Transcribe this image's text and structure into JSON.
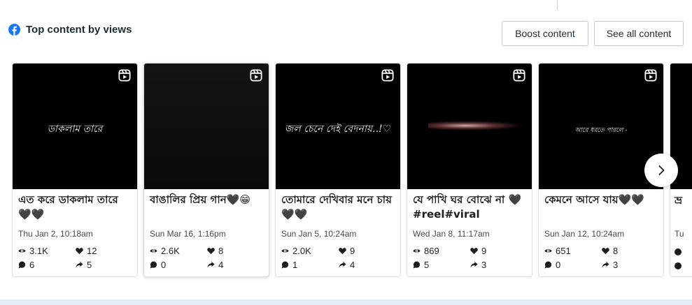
{
  "section": {
    "title": "Top content by views",
    "boost_label": "Boost content",
    "see_all_label": "See all content"
  },
  "colors": {
    "facebook_blue": "#1877f2",
    "border": "#dadde1",
    "thumbnail_bg": "#000000"
  },
  "cards": [
    {
      "thumb_text": "ডাকলাম তারে",
      "caption": "এত করে ডাকলাম তারে 🖤🖤",
      "date": "Thu Jan 2, 10:18am",
      "views": "3.1K",
      "likes": "12",
      "comments": "6",
      "shares": "5"
    },
    {
      "thumb_text": "",
      "caption": "বাঙালির প্রিয় গান🖤😁",
      "date": "Sun Mar 16, 1:16pm",
      "views": "2.6K",
      "likes": "8",
      "comments": "0",
      "shares": "4"
    },
    {
      "thumb_text": "জল চেনে দেই বেদনায়..!♡",
      "caption": "তোমারে দেখিবার মনে চায়🖤🖤",
      "date": "Sun Jan 5, 10:24am",
      "views": "2.0K",
      "likes": "9",
      "comments": "1",
      "shares": "4"
    },
    {
      "thumb_text": "",
      "caption": "যে পাখি ঘর বোঝে না 🖤 #reel#viral",
      "date": "Wed Jan 8, 11:17am",
      "views": "869",
      "likes": "9",
      "comments": "5",
      "shares": "3"
    },
    {
      "thumb_text": "আরে ধরতে পারলে -",
      "caption": "কেমনে আসে যায়🖤🖤",
      "date": "Sun Jan 12, 10:24am",
      "views": "651",
      "likes": "8",
      "comments": "0",
      "shares": "3"
    }
  ],
  "partial_card": {
    "caption": "ভ্র",
    "date": "Tu"
  }
}
